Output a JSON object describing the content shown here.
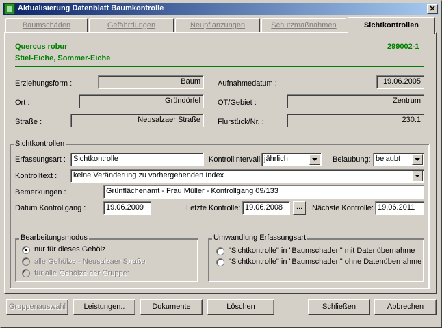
{
  "window": {
    "title": "Aktualisierung Datenblatt Baumkontrolle",
    "close_label": "✕"
  },
  "tabs": [
    {
      "label": "Baumschäden",
      "active": false
    },
    {
      "label": "Gefährdungen",
      "active": false
    },
    {
      "label": "Neupflanzungen",
      "active": false
    },
    {
      "label": "Schutzmaßnahmen",
      "active": false
    },
    {
      "label": "Sichtkontrollen",
      "active": true
    }
  ],
  "header": {
    "species_latin": "Quercus robur",
    "species_german": "Stiel-Eiche, Sommer-Eiche",
    "tree_id": "299002-1"
  },
  "tree_info": {
    "erziehungsform": {
      "label": "Erziehungsform :",
      "value": "Baum"
    },
    "aufnahmedatum": {
      "label": "Aufnahmedatum :",
      "value": "19.06.2005"
    },
    "ort": {
      "label": "Ort :",
      "value": "Gründörfel"
    },
    "ot_gebiet": {
      "label": "OT/Gebiet :",
      "value": "Zentrum"
    },
    "strasse": {
      "label": "Straße :",
      "value": "Neusalzaer Straße"
    },
    "flurstueck": {
      "label": "Flurstück/Nr. :",
      "value": "230.1"
    }
  },
  "sichtkontrollen": {
    "group_title": "Sichtkontrollen",
    "erfassungsart": {
      "label": "Erfassungsart :",
      "value": "Sichtkontrolle"
    },
    "kontrollintervall": {
      "label": "Kontrollintervall:",
      "value": "jährlich"
    },
    "belaubung": {
      "label": "Belaubung:",
      "value": "belaubt"
    },
    "kontrolltext": {
      "label": "Kontrolltext :",
      "value": "keine Veränderung zu vorhergehenden Index"
    },
    "bemerkungen": {
      "label": "Bemerkungen :",
      "value": "Grünflächenamt - Frau Müller - Kontrollgang 09/133"
    },
    "datum_kontrollgang": {
      "label": "Datum Kontrollgang :",
      "value": "19.06.2009"
    },
    "letzte_kontrolle": {
      "label": "Letzte Kontrolle:",
      "value": "19.06.2008"
    },
    "ellipsis_label": "...",
    "naechste_kontrolle": {
      "label": "Nächste Kontrolle:",
      "value": "19.06.2011"
    }
  },
  "bearbeitungsmodus": {
    "title": "Bearbeitungsmodus",
    "options": [
      {
        "label": "nur für dieses Gehölz",
        "checked": true,
        "enabled": true
      },
      {
        "label": "alle Gehölze - Neusalzaer Straße",
        "checked": false,
        "enabled": false
      },
      {
        "label": "für alle Gehölze der Gruppe:",
        "checked": false,
        "enabled": false
      }
    ]
  },
  "umwandlung": {
    "title": "Umwandlung Erfassungsart",
    "options": [
      {
        "label": "\"Sichtkontrolle\"  in \"Baumschaden\" mit Datenübernahme",
        "checked": false
      },
      {
        "label": "\"Sichtkontrolle\" in \"Baumschaden\" ohne Datenübernahme",
        "checked": false
      }
    ]
  },
  "buttons": {
    "gruppenauswahl": "Gruppenauswahl",
    "leistungen": "Leistungen..",
    "dokumente": "Dokumente",
    "loeschen": "Löschen",
    "schliessen": "Schließen",
    "abbrechen": "Abbrechen"
  }
}
